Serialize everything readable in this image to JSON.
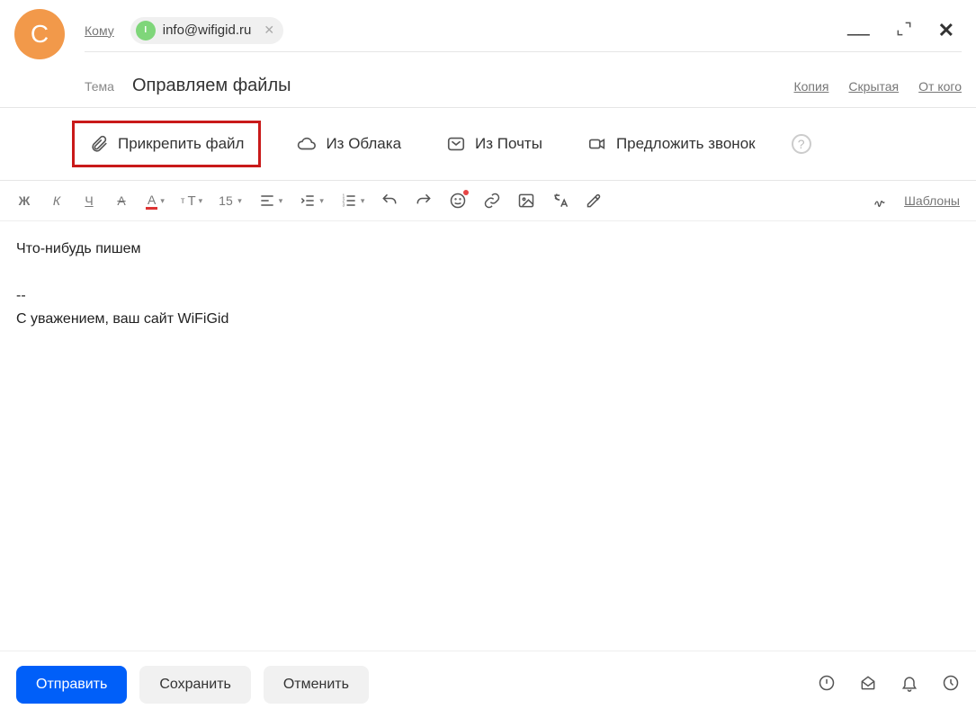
{
  "avatar_letter": "С",
  "to_label": "Кому",
  "recipient": {
    "email": "info@wifigid.ru",
    "badge": "I"
  },
  "subject_label": "Тема",
  "subject_value": "Оправляем файлы",
  "right_links": {
    "copy": "Копия",
    "hidden": "Скрытая",
    "from": "От кого"
  },
  "attach": {
    "attach_file": "Прикрепить файл",
    "from_cloud": "Из Облака",
    "from_mail": "Из Почты",
    "suggest_call": "Предложить звонок"
  },
  "toolbar": {
    "font_size": "15",
    "templates": "Шаблоны"
  },
  "body": {
    "line1": "Что-нибудь пишем",
    "sep": "--",
    "signature": "С уважением, ваш сайт WiFiGid"
  },
  "footer": {
    "send": "Отправить",
    "save": "Сохранить",
    "cancel": "Отменить"
  }
}
